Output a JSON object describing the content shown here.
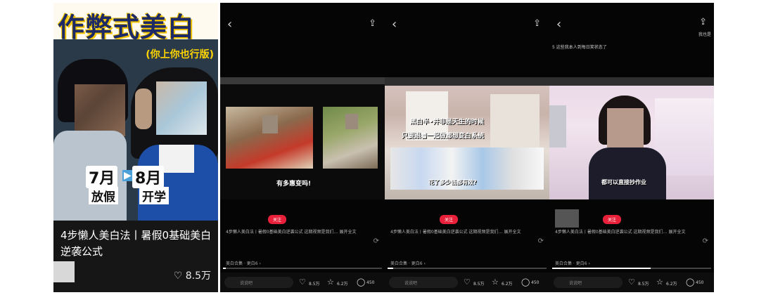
{
  "panel1": {
    "title": "作弊式美白",
    "subtitle": "(你上你也行版)",
    "month_from": "7月",
    "arrow": "▶",
    "month_to": "8月",
    "label_from": "放假",
    "label_to": "开学",
    "caption": "4步懒人美白法丨暑假0基础美白逆袭公式",
    "likes_icon": "♡",
    "likes": "8.5万"
  },
  "screens": [
    {
      "back_icon": "‹",
      "share_icon": "⇪",
      "video_text_1": "有多惠变吗!",
      "tag": "关注",
      "caption": "4步懒人美白法丨暑假0基础美白逆袭公式 这期视频是我们…  展开全文",
      "collection": "美白合集 · 更白6 ›",
      "input_placeholder": "说说吧",
      "like_count": "8.5万",
      "star_count": "6.2万",
      "comment_count": "450"
    },
    {
      "back_icon": "‹",
      "share_icon": "⇪",
      "video_text_1": "黑白半•并非是天生的时候",
      "video_text_2": "只要跟着一起做都想变白系统",
      "video_text_3": "花了多少钱都有效?",
      "tag": "关注",
      "caption": "4步懒人美白法丨暑假0基础美白逆袭公式 这期视频是我们…  展开全文",
      "collection": "美白合集 · 更白6 ›",
      "input_placeholder": "说说吧",
      "like_count": "8.5万",
      "star_count": "6.2万",
      "comment_count": "450"
    },
    {
      "back_icon": "‹",
      "share_icon": "⇪",
      "share_label": "我也是",
      "top_text": "5 这些我本人到每日笑状态了",
      "video_text_1": "都可以直接抄作业",
      "tag": "关注",
      "caption": "4步懒人美白法丨暑假0基础美白逆袭公式 这期视频是我们…  展开全文",
      "collection": "美白合集 · 更白6 ›",
      "input_placeholder": "说说吧",
      "like_count": "8.5万",
      "star_count": "6.2万",
      "comment_count": "450"
    }
  ],
  "icons": {
    "like": "♡",
    "star": "☆",
    "comment": "◯",
    "rotate": "⟳"
  },
  "colors": {
    "title_blue": "#1d2a66",
    "title_yellow": "#f2c500",
    "accent_red": "#e8203a",
    "subtitle_yellow": "#ffd400"
  }
}
